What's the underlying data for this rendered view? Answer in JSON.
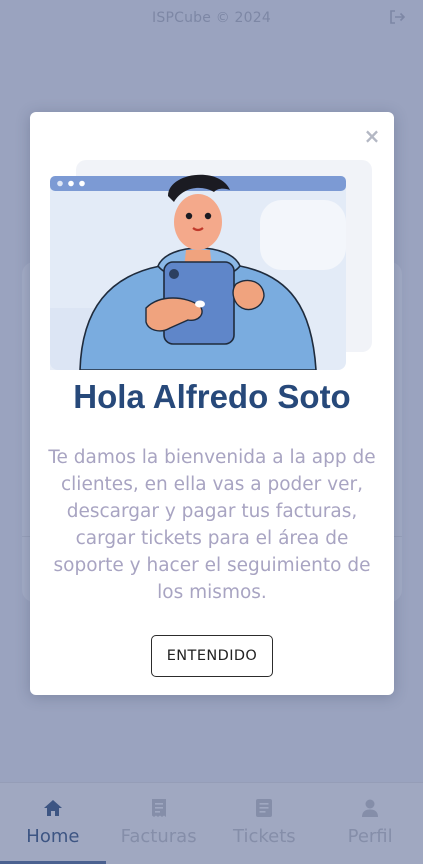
{
  "header": {
    "copyright": "ISPCube © 2024",
    "logout_icon": "logout-icon"
  },
  "modal": {
    "close_label": "×",
    "greeting_prefix": "Hola",
    "user_name": "Alfredo Soto",
    "message": "Te damos la bienvenida a la app de clientes, en ella vas a poder ver, descargar y pagar tus facturas, cargar tickets para el área de soporte y hacer el seguimiento de los mismos.",
    "confirm_label": "ENTENDIDO"
  },
  "tabbar": {
    "tabs": [
      {
        "label": "Home",
        "icon": "home-icon",
        "active": true
      },
      {
        "label": "Facturas",
        "icon": "invoice-icon",
        "active": false
      },
      {
        "label": "Tickets",
        "icon": "ticket-icon",
        "active": false
      },
      {
        "label": "Perfil",
        "icon": "user-icon",
        "active": false
      }
    ]
  },
  "colors": {
    "overlay_bg": "#9aa3bf",
    "title": "#27497a",
    "message": "#a8a4c2",
    "active_tab": "#3d5583"
  }
}
